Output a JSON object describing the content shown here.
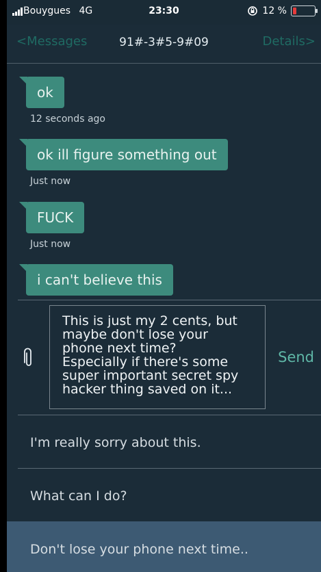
{
  "status": {
    "carrier": "Bouygues",
    "network": "4G",
    "time": "23:30",
    "battery": "12 %"
  },
  "nav": {
    "back_label": "Messages",
    "title": "91#-3#5-9#09",
    "details_label": "Details"
  },
  "messages": [
    {
      "text": "ok",
      "timestamp": "12 seconds ago"
    },
    {
      "text": "ok ill figure something out",
      "timestamp": "Just now"
    },
    {
      "text": "FUCK",
      "timestamp": "Just now"
    },
    {
      "text": "i can't believe this",
      "timestamp": ""
    }
  ],
  "compose": {
    "lines": [
      "This is just my 2 cents, but",
      "maybe don't lose your",
      "phone next time?",
      "Especially if there's some",
      "super important secret spy",
      "hacker thing saved on it..."
    ],
    "send_label": "Send"
  },
  "replies": [
    "I'm really sorry about this.",
    "What can I do?",
    "Don't lose your phone next time.."
  ],
  "colors": {
    "background": "#1b2c38",
    "bubble": "#3d8b7d",
    "accent": "#5fb7a7",
    "highlight": "#3d5a73"
  },
  "icons": {
    "signal": "signal-bars-icon",
    "orientation_lock": "rotation-lock-icon",
    "battery": "battery-icon",
    "attach": "paperclip-icon"
  }
}
